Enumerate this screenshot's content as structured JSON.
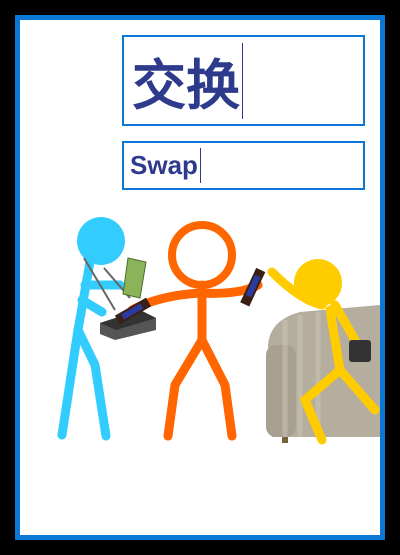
{
  "card": {
    "word_chinese": "交换",
    "word_english": "Swap"
  },
  "illustration": {
    "description_icon": "stick-figures-swap-illustration"
  },
  "colors": {
    "border": "#0a78d4",
    "text": "#2e3a8c",
    "blue_figure": "#33ccff",
    "orange_figure": "#ff6600",
    "yellow_figure": "#ffcc00"
  }
}
